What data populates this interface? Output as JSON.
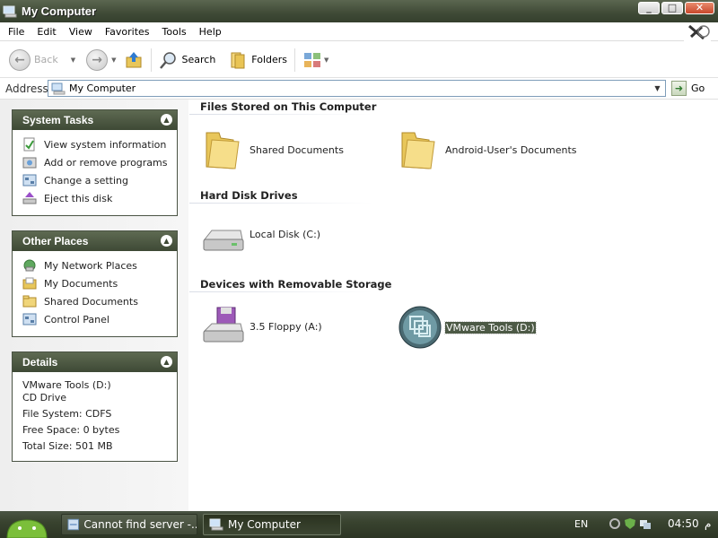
{
  "window": {
    "title": "My Computer",
    "icon": "my-computer-icon"
  },
  "menu": [
    "File",
    "Edit",
    "View",
    "Favorites",
    "Tools",
    "Help"
  ],
  "toolbar": {
    "back_label": "Back",
    "search_label": "Search",
    "folders_label": "Folders"
  },
  "address": {
    "label": "Address",
    "value": "My Computer",
    "go_label": "Go"
  },
  "system_tasks": {
    "title": "System Tasks",
    "items": [
      {
        "label": "View system information",
        "icon": "system-info-icon"
      },
      {
        "label": "Add or remove programs",
        "icon": "add-remove-programs-icon"
      },
      {
        "label": "Change a setting",
        "icon": "control-panel-icon"
      },
      {
        "label": "Eject this disk",
        "icon": "eject-icon"
      }
    ]
  },
  "other_places": {
    "title": "Other Places",
    "items": [
      {
        "label": "My Network Places",
        "icon": "network-places-icon"
      },
      {
        "label": "My Documents",
        "icon": "my-documents-icon"
      },
      {
        "label": "Shared Documents",
        "icon": "folder-icon"
      },
      {
        "label": "Control Panel",
        "icon": "control-panel-icon"
      }
    ]
  },
  "details": {
    "title": "Details",
    "name": "VMware Tools (D:)",
    "type": "CD Drive",
    "file_system": "File System: CDFS",
    "free_space": "Free Space: 0 bytes",
    "total_size": "Total Size: 501 MB"
  },
  "content": {
    "groups": [
      {
        "title": "Files Stored on This Computer",
        "items": [
          "Shared Documents",
          "Android-User's Documents"
        ]
      },
      {
        "title": "Hard Disk Drives",
        "items": [
          "Local Disk (C:)"
        ]
      },
      {
        "title": "Devices with Removable Storage",
        "items": [
          "3.5 Floppy (A:)",
          "VMware Tools (D:)"
        ]
      }
    ],
    "selected_item": "VMware Tools (D:)"
  },
  "taskbar": {
    "tasks": [
      {
        "label": "Cannot find server -...",
        "active": false
      },
      {
        "label": "My Computer",
        "active": true
      }
    ],
    "language": "EN",
    "clock": "04:50",
    "ampm": "م"
  },
  "colors": {
    "title_bar": "#3f4a36",
    "panel_header": "#4a5544",
    "selection": "#4d5a46"
  }
}
